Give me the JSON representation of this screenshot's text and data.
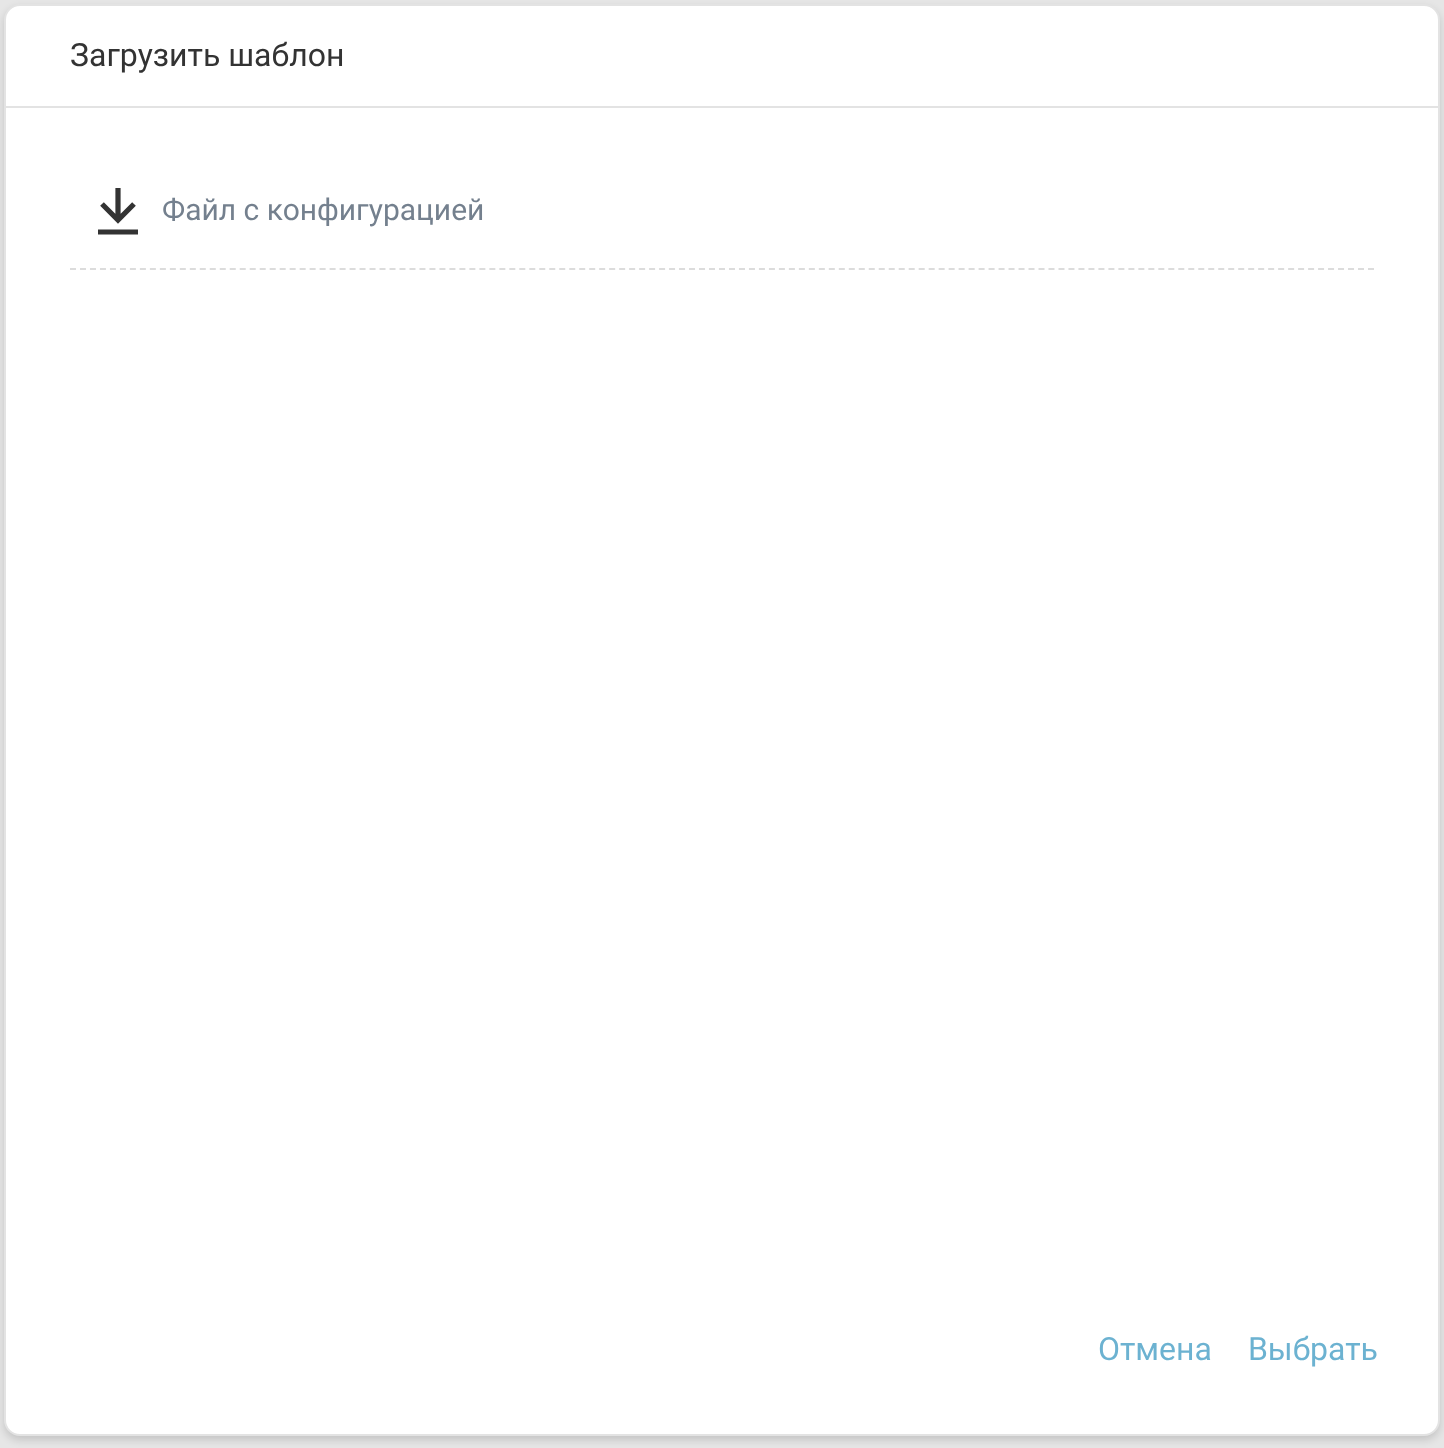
{
  "dialog": {
    "title": "Загрузить шаблон"
  },
  "file_field": {
    "placeholder": "Файл с конфигурацией"
  },
  "buttons": [
    {
      "label": "Отмена"
    },
    {
      "label": "Выбрать"
    }
  ]
}
